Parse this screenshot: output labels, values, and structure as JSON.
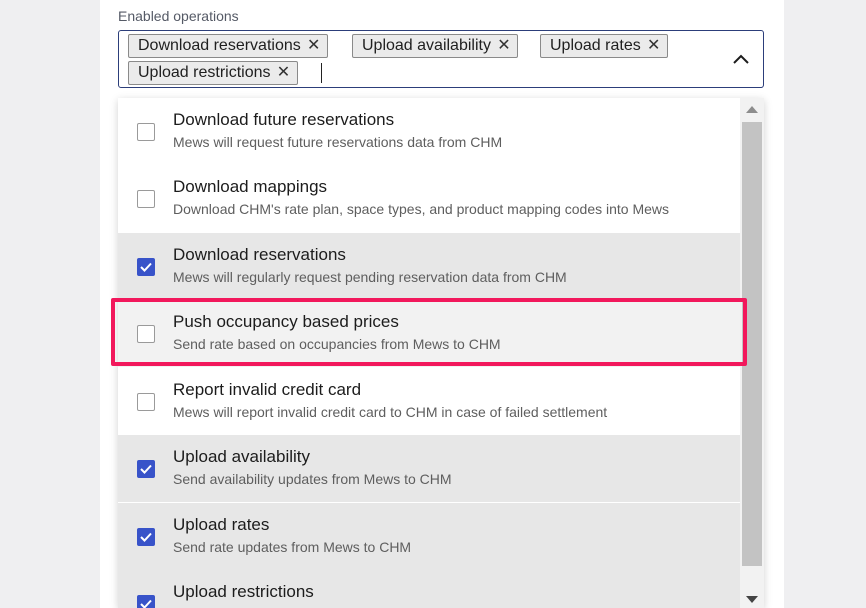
{
  "field": {
    "label": "Enabled operations",
    "chips": [
      {
        "label": "Download reservations",
        "remove_icon": "close-icon"
      },
      {
        "label": "Upload availability",
        "remove_icon": "close-icon"
      },
      {
        "label": "Upload rates",
        "remove_icon": "close-icon"
      },
      {
        "label": "Upload restrictions",
        "remove_icon": "close-icon"
      }
    ],
    "toggle_icon": "chevron-up-icon"
  },
  "options": [
    {
      "title": "Download future reservations",
      "description": "Mews will request future reservations data from CHM",
      "checked": false
    },
    {
      "title": "Download mappings",
      "description": "Download CHM's rate plan, space types, and product mapping codes into Mews",
      "checked": false
    },
    {
      "title": "Download reservations",
      "description": "Mews will regularly request pending reservation data from CHM",
      "checked": true
    },
    {
      "title": "Push occupancy based prices",
      "description": "Send rate based on occupancies from Mews to CHM",
      "checked": false
    },
    {
      "title": "Report invalid credit card",
      "description": "Mews will report invalid credit card to CHM in case of failed settlement",
      "checked": false
    },
    {
      "title": "Upload availability",
      "description": "Send availability updates from Mews to CHM",
      "checked": true
    },
    {
      "title": "Upload rates",
      "description": "Send rate updates from Mews to CHM",
      "checked": true
    },
    {
      "title": "Upload restrictions",
      "description": "",
      "checked": true
    }
  ],
  "colors": {
    "checkbox_checked": "#3853c9",
    "highlight_border": "#f2185c",
    "selected_row_bg": "#e7e7e7"
  }
}
